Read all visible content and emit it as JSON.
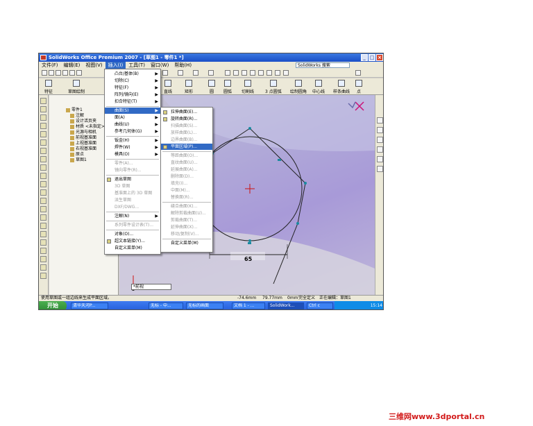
{
  "window": {
    "title": "SolidWorks Office Premium 2007 - [草图1 - 零件1 *]",
    "min": "_",
    "max": "□",
    "close": "×"
  },
  "menubar": {
    "items": [
      "文件(F)",
      "编辑(E)",
      "视图(V)",
      "插入(I)",
      "工具(T)",
      "窗口(W)",
      "帮助(H)"
    ],
    "search_placeholder": "SolidWorks 搜索"
  },
  "commands": [
    "特征",
    "草图绘制",
    "直线",
    "矩形",
    "圆",
    "圆弧",
    "切割线",
    "3 点圆弧",
    "绘制圆角",
    "中心线",
    "样条曲线",
    "点"
  ],
  "feature_tree": {
    "items": [
      "零件1",
      "注解",
      "设计活页夹",
      "材质 <未指定>",
      "光源与相机",
      "前视基准面",
      "上视基准面",
      "右视基准面",
      "原点",
      "草图1"
    ]
  },
  "insert_menu": {
    "items": [
      {
        "label": "凸台/基体(B)",
        "arrow": true
      },
      {
        "label": "切除(C)",
        "arrow": true
      },
      {
        "label": "特征(F)",
        "arrow": true
      },
      {
        "label": "阵列/镜向(E)",
        "arrow": true
      },
      {
        "label": "扣合特征(T)",
        "arrow": true
      },
      {
        "label": "曲面(S)",
        "arrow": true,
        "hl": true
      },
      {
        "label": "面(A)",
        "arrow": true
      },
      {
        "label": "曲线(U)",
        "arrow": true
      },
      {
        "label": "参考几何体(G)",
        "arrow": true
      },
      {
        "label": "钣金(H)",
        "arrow": true
      },
      {
        "label": "焊件(W)",
        "arrow": true
      },
      {
        "label": "模具(O)",
        "arrow": true
      },
      {
        "label": "零件(A)...",
        "dis": true
      },
      {
        "label": "镜向零件(R)...",
        "dis": true
      },
      {
        "label": "退出草图",
        "icon": true
      },
      {
        "label": "3D 草图",
        "dis": true
      },
      {
        "label": "基准面上的 3D 草图",
        "dis": true
      },
      {
        "label": "派生草图",
        "dis": true
      },
      {
        "label": "DXF/DWG...",
        "dis": true
      },
      {
        "label": "注解(N)",
        "arrow": true
      },
      {
        "label": "系列零件设计表(T)...",
        "dis": true
      },
      {
        "label": "对象(O)..."
      },
      {
        "label": "超文本链接(Y)...",
        "icon": true
      },
      {
        "label": "自定义菜单(M)"
      }
    ]
  },
  "surface_menu": {
    "items": [
      {
        "label": "拉伸曲面(E)...",
        "icon": true
      },
      {
        "label": "旋转曲面(R)...",
        "icon": true
      },
      {
        "label": "扫描曲面(S)...",
        "dis": true
      },
      {
        "label": "放样曲面(L)...",
        "dis": true
      },
      {
        "label": "边界曲面(B)...",
        "dis": true
      },
      {
        "label": "平面区域(P)...",
        "hl": true,
        "icon": true
      },
      {
        "label": "等距曲面(O)...",
        "dis": true
      },
      {
        "label": "直纹曲面(U)...",
        "dis": true
      },
      {
        "label": "延展曲面(A)...",
        "dis": true
      },
      {
        "label": "删除面(D)...",
        "dis": true
      },
      {
        "label": "填充(I)...",
        "dis": true
      },
      {
        "label": "中面(M)...",
        "dis": true
      },
      {
        "label": "替换面(R)...",
        "dis": true
      },
      {
        "label": "缝合曲面(K)...",
        "dis": true
      },
      {
        "label": "解除剪裁曲面(U)...",
        "dis": true
      },
      {
        "label": "剪裁曲面(T)...",
        "dis": true
      },
      {
        "label": "延伸曲面(X)...",
        "dis": true
      },
      {
        "label": "移动/复制(V)...",
        "dis": true
      },
      {
        "label": "自定义菜单(M)"
      }
    ]
  },
  "sketch": {
    "dimension": "65"
  },
  "view_select": "*前视",
  "status": {
    "hint": "使用草图或一组边线来生成平面区域。",
    "x": "-74.6mm",
    "y": "79.77mm",
    "z": "0mm",
    "state": "完全定义",
    "editing": "正在编辑：草图1"
  },
  "taskbar": {
    "start": "开始",
    "tasks": [
      "清华天河P...",
      "无标 - 中...",
      "无标的画面",
      "文档 1 - ...",
      "SolidWork...",
      "Ctrl c"
    ],
    "clock": "15:14"
  },
  "watermark": "三维网www.3dportal.cn"
}
